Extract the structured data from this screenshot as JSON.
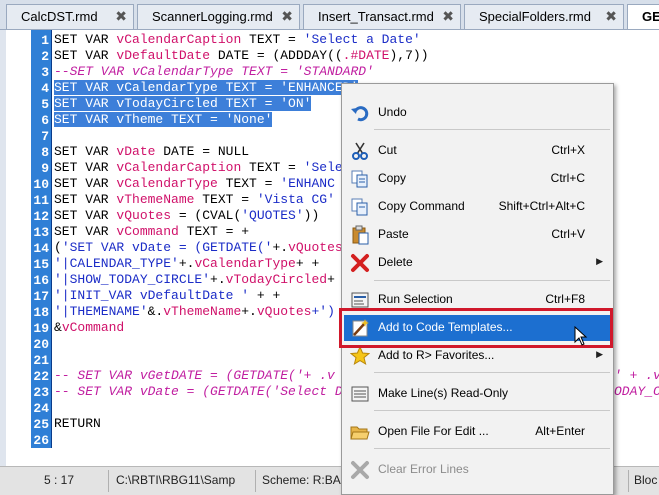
{
  "tabs": [
    {
      "label": "CalcDST.rmd",
      "close": "✖"
    },
    {
      "label": "ScannerLogging.rmd",
      "close": "✖"
    },
    {
      "label": "Insert_Transact.rmd",
      "close": "✖"
    },
    {
      "label": "SpecialFolders.rmd",
      "close": "✖"
    },
    {
      "label": "GET",
      "close": ""
    }
  ],
  "editor": {
    "lines": [
      {
        "n": "1"
      },
      {
        "n": "2"
      },
      {
        "n": "3"
      },
      {
        "n": "4"
      },
      {
        "n": "5"
      },
      {
        "n": "6"
      },
      {
        "n": "7"
      },
      {
        "n": "8"
      },
      {
        "n": "9"
      },
      {
        "n": "10"
      },
      {
        "n": "11"
      },
      {
        "n": "12"
      },
      {
        "n": "13"
      },
      {
        "n": "14"
      },
      {
        "n": "15"
      },
      {
        "n": "16"
      },
      {
        "n": "17"
      },
      {
        "n": "18"
      },
      {
        "n": "19"
      },
      {
        "n": "20"
      },
      {
        "n": "21"
      },
      {
        "n": "22"
      },
      {
        "n": "23"
      },
      {
        "n": "24"
      },
      {
        "n": "25"
      },
      {
        "n": "26"
      }
    ],
    "code": {
      "l1a": "SET VAR ",
      "l1b": "vCalendarCaption",
      "l1c": " TEXT = ",
      "l1d": "'Select a Date'",
      "l2a": "SET VAR ",
      "l2b": "vDefaultDate",
      "l2c": " DATE = (ADDDAY((",
      "l2d": ".#DATE",
      "l2e": "),7))",
      "l3": "--SET VAR vCalendarType TEXT = 'STANDARD'",
      "l4": "SET VAR vCalendarType TEXT = 'ENHANCED'",
      "l5": "SET VAR vTodayCircled TEXT = 'ON'",
      "l6": "SET VAR vTheme TEXT = 'None'",
      "l8a": "SET VAR ",
      "l8b": "vDate",
      "l8c": " DATE = NULL",
      "l9a": "SET VAR ",
      "l9b": "vCalendarCaption",
      "l9c": " TEXT = ",
      "l9d": "'Sele",
      "l10a": "SET VAR ",
      "l10b": "vCalendarType",
      "l10c": " TEXT = ",
      "l10d": "'ENHANC",
      "l11a": "SET VAR ",
      "l11b": "vThemeName",
      "l11c": " TEXT = ",
      "l11d": "'Vista CG'",
      "l12a": "SET VAR ",
      "l12b": "vQuotes",
      "l12c": " = (CVAL(",
      "l12d": "'QUOTES'",
      "l12e": "))",
      "l13a": "SET VAR ",
      "l13b": "vCommand",
      "l13c": " TEXT = +",
      "l14a": "(",
      "l14b": "'SET VAR vDate = (GETDATE('",
      "l14c": "+.",
      "l14d": "vQuotes",
      "l15a": "'|CALENDAR_TYPE'",
      "l15b": "+.",
      "l15c": "vCalendarType",
      "l15d": "+ +",
      "l16a": "'|SHOW_TODAY_CIRCLE'",
      "l16b": "+.",
      "l16c": "vTodayCircled",
      "l16d": "+",
      "l17a": "'|INIT_VAR vDefaultDate '",
      "l17b": " + +",
      "l18a": "'|THEMENAME'",
      "l18b": "&.",
      "l18c": "vThemeName",
      "l18d": "+.",
      "l18e": "vQuotes",
      "l18f": "+')",
      "l19a": "&",
      "l19b": "vCommand",
      "l22a": "-- SET VAR vGetDATE = (GETDATE('+ .v",
      "l22b": "' + .v",
      "l23a": "-- SET VAR vDate = (GETDATE('Select D",
      "l23b": "ODAY_C",
      "l25": "RETURN"
    }
  },
  "context_menu": {
    "items": [
      {
        "label": "Undo",
        "shortcut": "",
        "icon": "undo-icon"
      },
      {
        "label": "Cut",
        "shortcut": "Ctrl+X",
        "icon": "scissors-icon"
      },
      {
        "label": "Copy",
        "shortcut": "Ctrl+C",
        "icon": "copy-icon"
      },
      {
        "label": "Copy Command",
        "shortcut": "Shift+Ctrl+Alt+C",
        "icon": "copy-command-icon"
      },
      {
        "label": "Paste",
        "shortcut": "Ctrl+V",
        "icon": "paste-icon"
      },
      {
        "label": "Delete",
        "shortcut": "",
        "icon": "delete-x-icon"
      },
      {
        "label": "Run Selection",
        "shortcut": "Ctrl+F8",
        "icon": "run-selection-icon"
      },
      {
        "label": "Add to Code Templates...",
        "shortcut": "",
        "icon": "magic-wand-icon"
      },
      {
        "label": "Add to R> Favorites...",
        "shortcut": "",
        "icon": "star-icon"
      },
      {
        "label": "Make Line(s) Read-Only",
        "shortcut": "",
        "icon": "lock-line-icon"
      },
      {
        "label": "Open File For Edit ...",
        "shortcut": "Alt+Enter",
        "icon": "folder-open-icon"
      },
      {
        "label": "Clear Error Lines",
        "shortcut": "",
        "icon": "clear-error-icon"
      }
    ]
  },
  "status": {
    "position": "5 : 17",
    "path": "C:\\RBTI\\RBG11\\Samp",
    "scheme": "Scheme: R:BASE",
    "right": "Bloc"
  },
  "colors": {
    "highlight": "#1c6fd0",
    "callout": "#d0182b",
    "gutter": "#2f7fd6"
  }
}
